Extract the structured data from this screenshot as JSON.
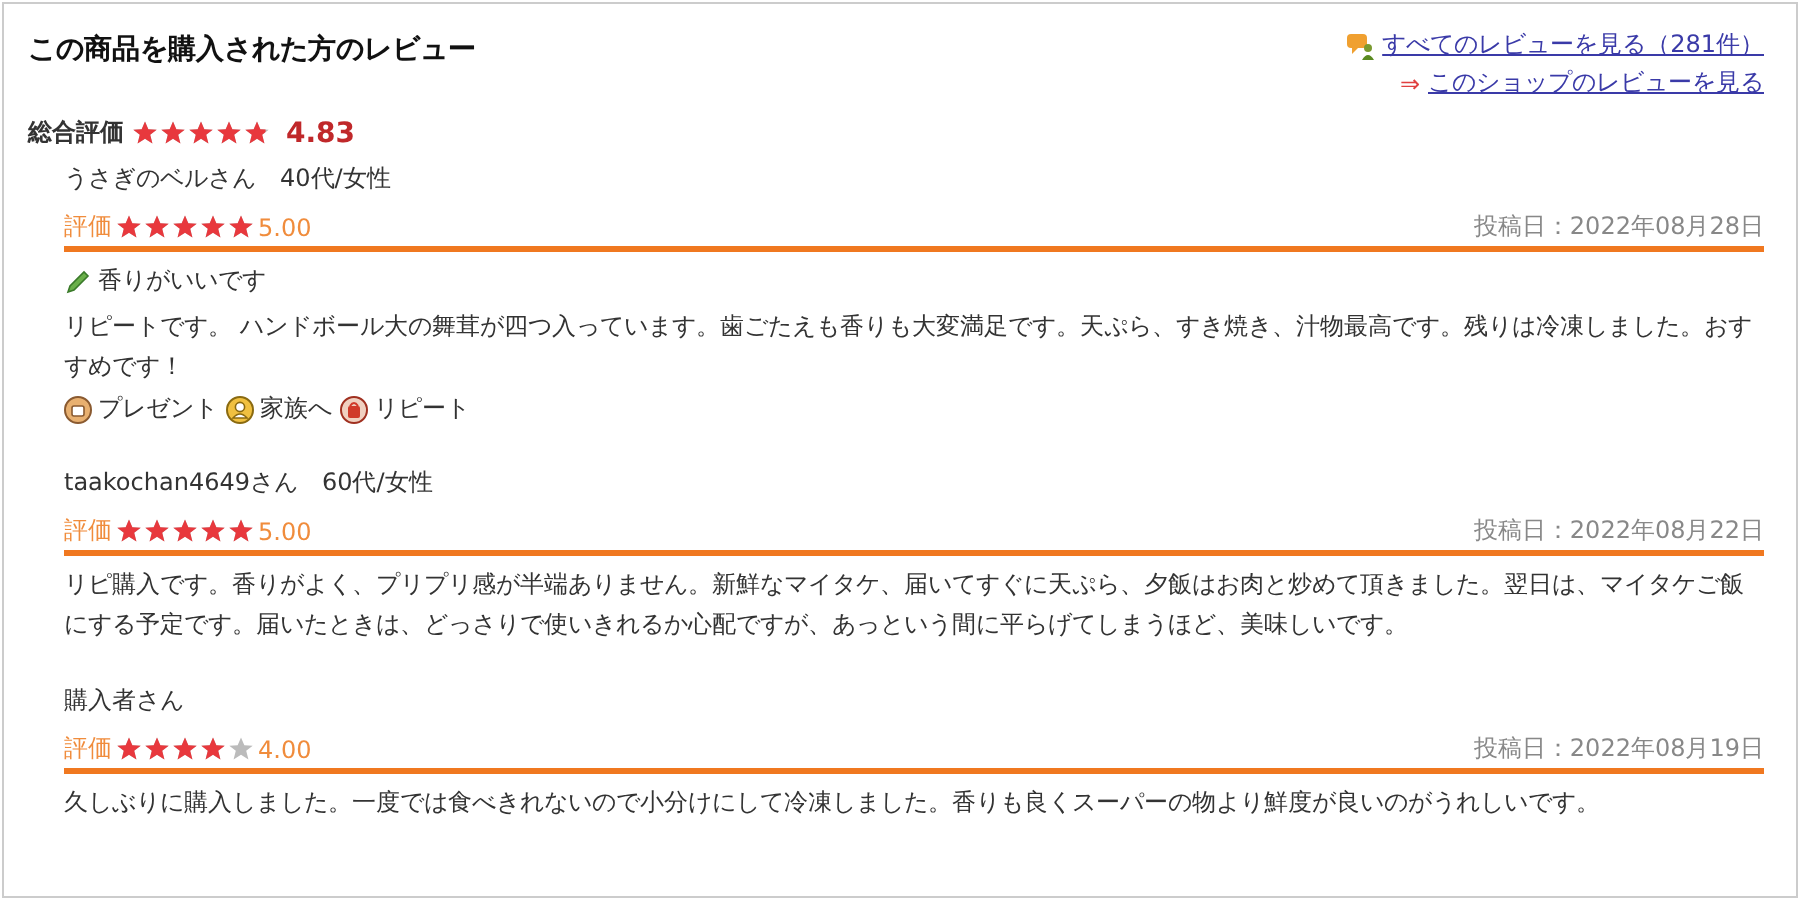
{
  "header": {
    "title": "この商品を購入された方のレビュー",
    "links": [
      {
        "kind": "all",
        "label": "すべてのレビューを見る（281件）"
      },
      {
        "kind": "shop",
        "arrow": "⇒",
        "label": "このショップのレビューを見る"
      }
    ]
  },
  "overall": {
    "label": "総合評価",
    "stars": 4.83,
    "score": "4.83"
  },
  "reviews": [
    {
      "reviewer": "うさぎのベルさん　40代/女性",
      "rating_label": "評価",
      "stars": 5,
      "score": "5.00",
      "date": "投稿日：2022年08月28日",
      "headline": "香りがいいです",
      "body": "リピートです。 ハンドボール大の舞茸が四つ入っています。歯ごたえも香りも大変満足です。天ぷら、すき焼き、汁物最高です。残りは冷凍しました。おすすめです！",
      "tags": [
        {
          "kind": "present",
          "label": "プレゼント"
        },
        {
          "kind": "family",
          "label": "家族へ"
        },
        {
          "kind": "repeat",
          "label": "リピート"
        }
      ]
    },
    {
      "reviewer": "taakochan4649さん　60代/女性",
      "rating_label": "評価",
      "stars": 5,
      "score": "5.00",
      "date": "投稿日：2022年08月22日",
      "body": "リピ購入です。香りがよく、プリプリ感が半端ありません。新鮮なマイタケ、届いてすぐに天ぷら、夕飯はお肉と炒めて頂きました。翌日は、マイタケご飯にする予定です。届いたときは、どっさりで使いきれるか心配ですが、あっという間に平らげてしまうほど、美味しいです。"
    },
    {
      "reviewer": "購入者さん",
      "rating_label": "評価",
      "stars": 4,
      "score": "4.00",
      "date": "投稿日：2022年08月19日",
      "body": "久しぶりに購入しました。一度では食べきれないので小分けにして冷凍しました。香りも良くスーパーの物より鮮度が良いのがうれしいです。"
    }
  ]
}
